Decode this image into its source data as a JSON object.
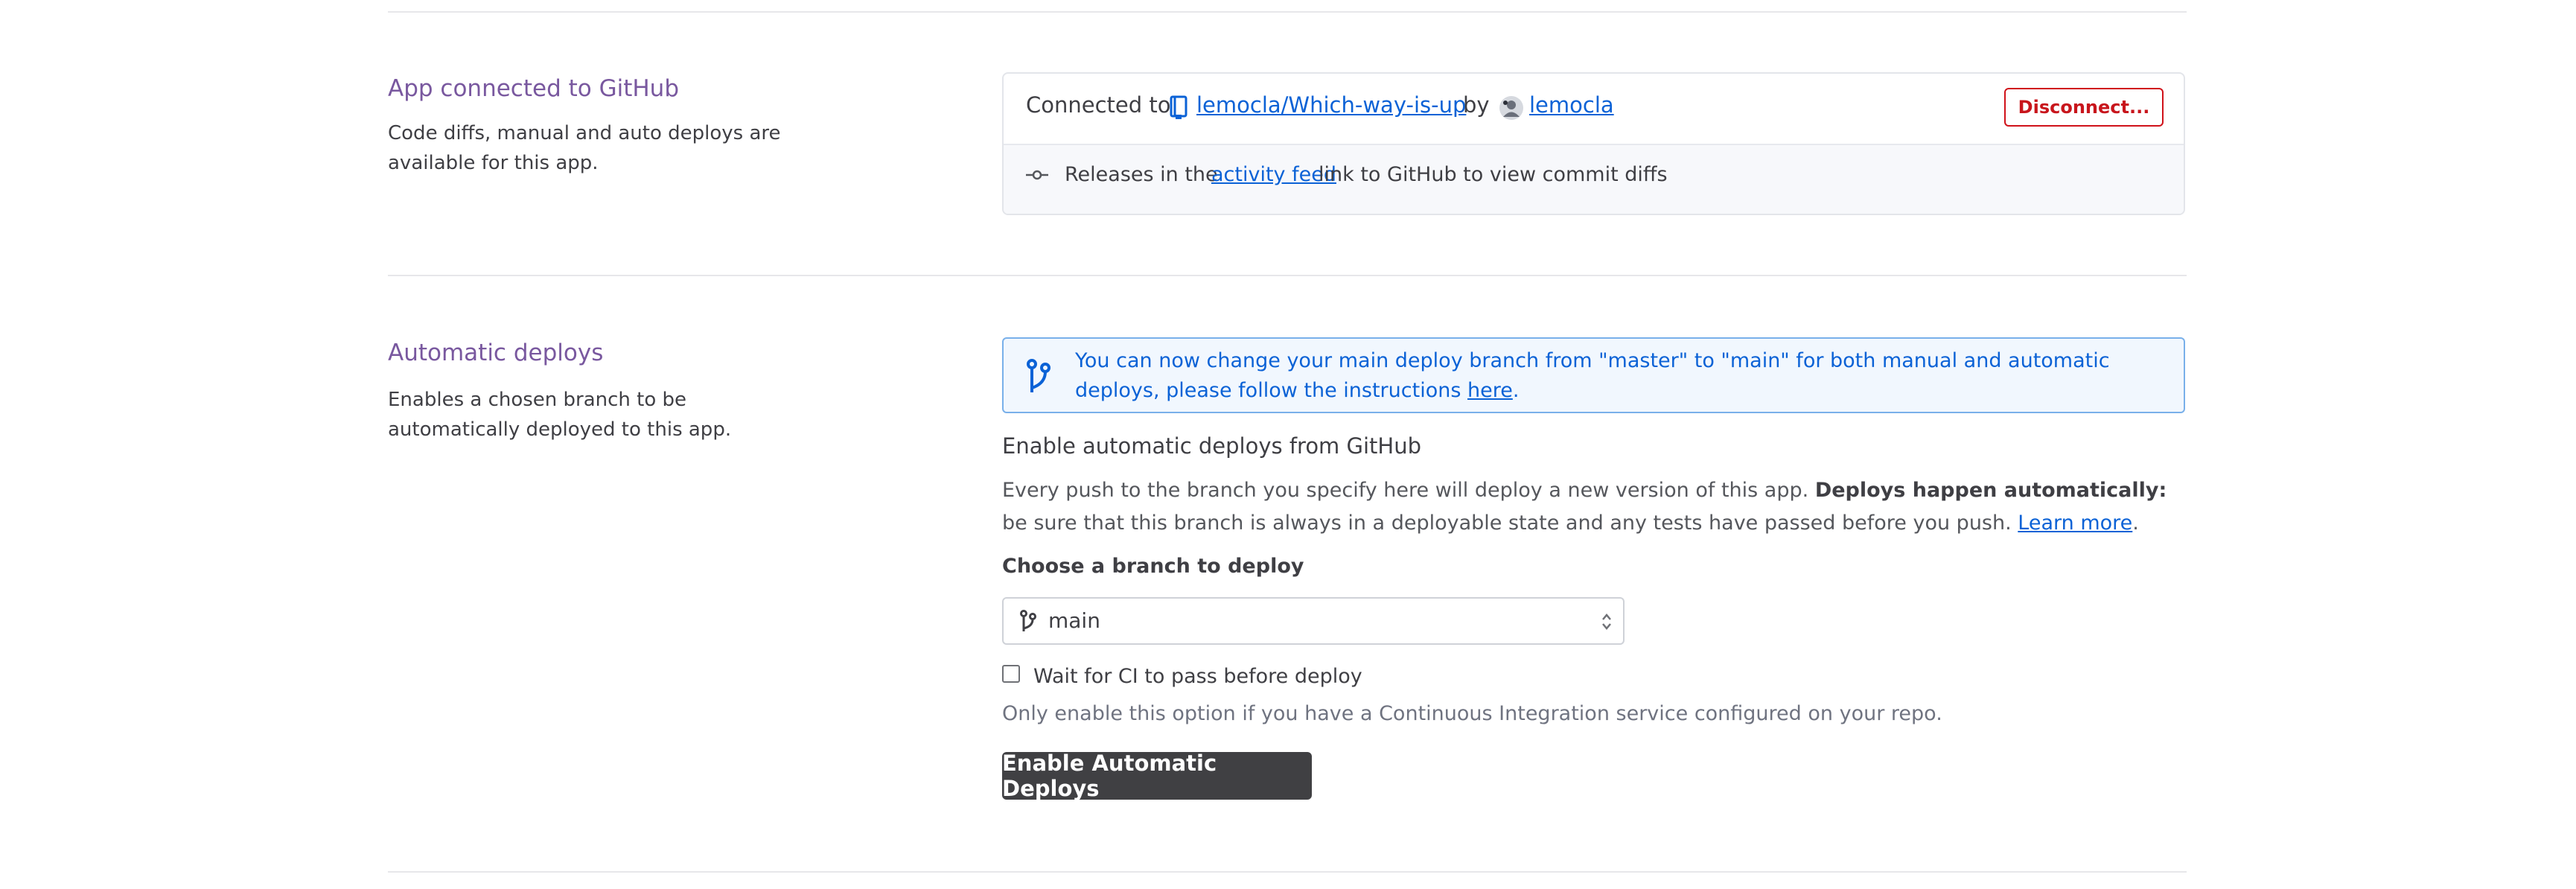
{
  "github_section": {
    "title": "App connected to GitHub",
    "description": "Code diffs, manual and auto deploys are available for this app.",
    "connected_prefix": "Connected to",
    "repo_link": "lemocla/Which-way-is-up",
    "by_label": "by",
    "user_link": "lemocla",
    "disconnect_label": "Disconnect...",
    "releases_prefix": "Releases in the",
    "activity_feed_link": "activity feed",
    "releases_suffix": "link to GitHub to view commit diffs"
  },
  "auto_deploy_section": {
    "title": "Automatic deploys",
    "description": "Enables a chosen branch to be automatically deployed to this app.",
    "banner_text": "You can now change your main deploy branch from \"master\" to \"main\" for both manual and automatic deploys, please follow the instructions",
    "banner_link": "here",
    "banner_end": ".",
    "enable_heading": "Enable automatic deploys from GitHub",
    "body_text_1": "Every push to the branch you specify here will deploy a new version of this app.",
    "body_bold": "Deploys happen automatically:",
    "body_text_2": "be sure that this branch is always in a deployable state and any tests have passed before you push.",
    "learn_more_link": "Learn more",
    "body_end": ".",
    "branch_label": "Choose a branch to deploy",
    "branch_value": "main",
    "ci_checkbox_label": "Wait for CI to pass before deploy",
    "ci_checked": false,
    "ci_help": "Only enable this option if you have a Continuous Integration service configured on your repo.",
    "enable_button": "Enable Automatic Deploys"
  },
  "colors": {
    "section_title": "#79589f",
    "link": "#0b62d6",
    "danger": "#c8151c",
    "primary_button": "#404043",
    "banner_border": "#79b0ea"
  },
  "icons": [
    "repo-book-icon",
    "user-avatar-icon",
    "commit-icon",
    "branch-icon",
    "select-arrows-icon"
  ]
}
